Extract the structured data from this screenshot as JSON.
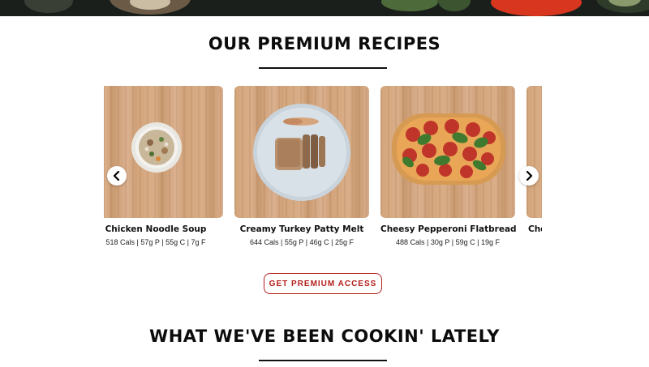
{
  "header": {
    "title": "OUR PREMIUM RECIPES"
  },
  "recipes": [
    {
      "name": "Chicken Noodle Soup",
      "macros": "518 Cals | 57g P | 55g C | 7g F"
    },
    {
      "name": "Creamy Turkey Patty Melt",
      "macros": "644 Cals | 55g P | 46g C | 25g F"
    },
    {
      "name": "Cheesy Pepperoni Flatbread",
      "macros": "488 Cals | 30g P | 59g C | 19g F"
    },
    {
      "name": "Cho",
      "macros": ""
    }
  ],
  "cta": {
    "label": "GET PREMIUM ACCESS"
  },
  "latest": {
    "title": "WHAT WE'VE BEEN COOKIN' LATELY"
  },
  "icons": {
    "prev": "chevron-left-icon",
    "next": "chevron-right-icon"
  },
  "colors": {
    "accent": "#b3201b",
    "text": "#111111",
    "wood": "#d3a57c"
  }
}
